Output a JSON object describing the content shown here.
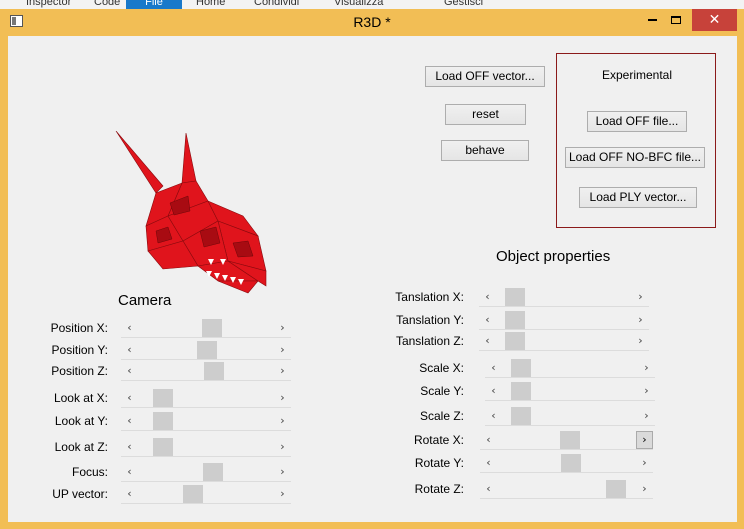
{
  "background_app": {
    "tabs": [
      "Inspector",
      "Code",
      "File",
      "Home",
      "Condividi",
      "Visualizza",
      "Gestisci"
    ]
  },
  "window": {
    "title": "R3D *",
    "min_icon": "minimize-icon",
    "max_icon": "maximize-icon",
    "close_glyph": "✕"
  },
  "buttons": {
    "load_off_vector": "Load OFF vector...",
    "reset": "reset",
    "behave": "behave"
  },
  "experimental": {
    "title": "Experimental",
    "load_off_file": "Load OFF file...",
    "load_off_nobfc": "Load OFF NO-BFC file...",
    "load_ply_vector": "Load PLY vector..."
  },
  "camera": {
    "heading": "Camera",
    "sliders": [
      {
        "label": "Position X:",
        "value": 0.55
      },
      {
        "label": "Position Y:",
        "value": 0.51
      },
      {
        "label": "Position Z:",
        "value": 0.57
      },
      {
        "label": "Look at X:",
        "value": 0.13
      },
      {
        "label": "Look at Y:",
        "value": 0.13
      },
      {
        "label": "Look at Z:",
        "value": 0.13
      },
      {
        "label": "Focus:",
        "value": 0.56
      },
      {
        "label": "UP vector:",
        "value": 0.39
      }
    ]
  },
  "object": {
    "heading": "Object properties",
    "sliders": [
      {
        "label": "Tanslation X:",
        "value": 0.08
      },
      {
        "label": "Tanslation Y:",
        "value": 0.08
      },
      {
        "label": "Tanslation Z:",
        "value": 0.08
      },
      {
        "label": "Scale X:",
        "value": 0.08
      },
      {
        "label": "Scale Y:",
        "value": 0.08
      },
      {
        "label": "Scale Z:",
        "value": 0.08
      },
      {
        "label": "Rotate X:",
        "value": 0.53
      },
      {
        "label": "Rotate Y:",
        "value": 0.54
      },
      {
        "label": "Rotate Z:",
        "value": 0.92
      }
    ]
  },
  "arrows": {
    "left": "‹",
    "right": "›"
  },
  "colors": {
    "accent": "#1979ca",
    "frame": "#f2be55",
    "close": "#c7423a",
    "model": "#e0141c",
    "exp_border": "#8b1a1a"
  }
}
